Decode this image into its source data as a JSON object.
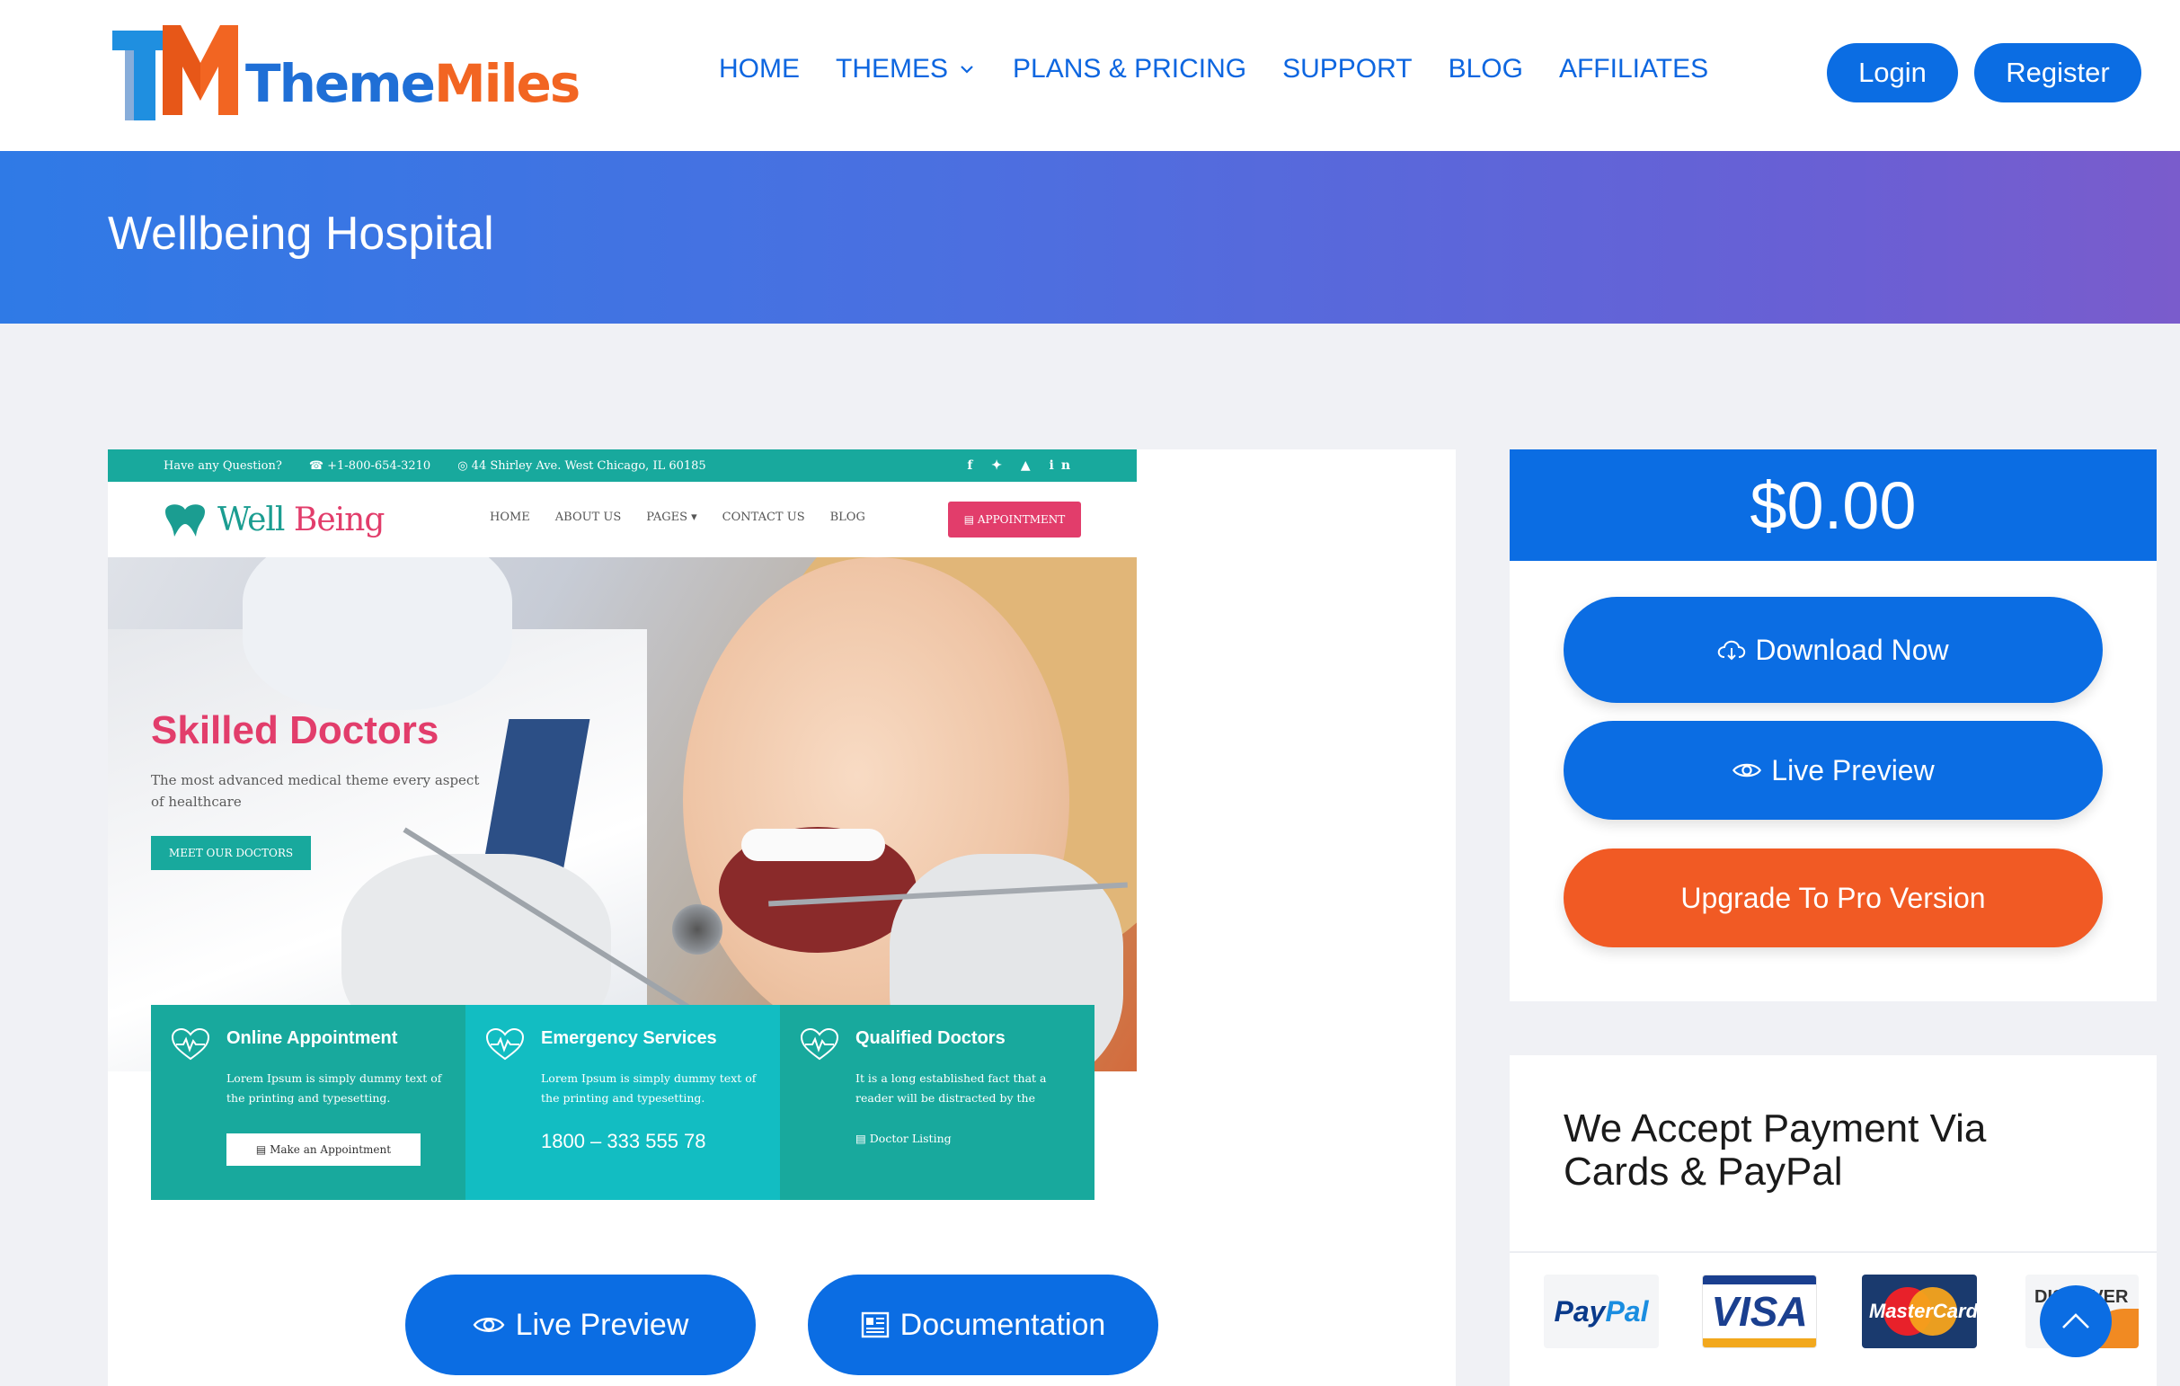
{
  "header": {
    "logo": {
      "part1": "Theme",
      "part2": "Miles",
      "mark": "TM"
    },
    "nav": [
      {
        "label": "HOME"
      },
      {
        "label": "THEMES",
        "icon": "chevron-down-icon"
      },
      {
        "label": "PLANS & PRICING"
      },
      {
        "label": "SUPPORT"
      },
      {
        "label": "BLOG"
      },
      {
        "label": "AFFILIATES"
      }
    ],
    "login_label": "Login",
    "register_label": "Register"
  },
  "banner": {
    "title": "Wellbeing Hospital"
  },
  "preview": {
    "topbar": {
      "question": "Have any Question?",
      "phone": "☎ +1-800-654-3210",
      "address": "◎ 44 Shirley Ave. West Chicago, IL 60185",
      "social": "f ✦ ▲ in"
    },
    "logo": {
      "part1": "Well",
      "part2": "Being"
    },
    "menu": [
      "HOME",
      "ABOUT US",
      "PAGES ▾",
      "CONTACT US",
      "BLOG"
    ],
    "appointment_label": "▤  APPOINTMENT",
    "hero": {
      "title": "Skilled Doctors",
      "subtitle": "The most advanced medical theme  every aspect of healthcare",
      "button": "MEET OUR DOCTORS"
    },
    "features": [
      {
        "title": "Online Appointment",
        "text": "Lorem Ipsum is simply dummy text of the printing and typesetting.",
        "button": "▤  Make an Appointment"
      },
      {
        "title": "Emergency Services",
        "text": "Lorem Ipsum is simply dummy text of the printing and typesetting.",
        "phone": "1800 – 333 555 78"
      },
      {
        "title": "Qualified Doctors",
        "text": "It is a long established fact that a reader will be distracted by the",
        "link": "▤  Doctor Listing"
      }
    ]
  },
  "actions": {
    "live_preview_label": "Live Preview",
    "documentation_label": "Documentation"
  },
  "sidebar": {
    "price": "$0.00",
    "download_label": "Download Now",
    "live_preview_label": "Live Preview",
    "upgrade_label": "Upgrade To Pro Version"
  },
  "payment": {
    "title": "We Accept Payment Via Cards & PayPal",
    "cards": {
      "paypal": {
        "part1": "Pay",
        "part2": "Pal"
      },
      "visa": "VISA",
      "mastercard": "MasterCard",
      "discover": "DISCOVER"
    }
  },
  "colors": {
    "primary": "#0b6de3",
    "accent": "#f15a24",
    "banner_start": "#2f7ae6",
    "banner_end": "#7a5ccc",
    "teal": "#18a99d"
  }
}
